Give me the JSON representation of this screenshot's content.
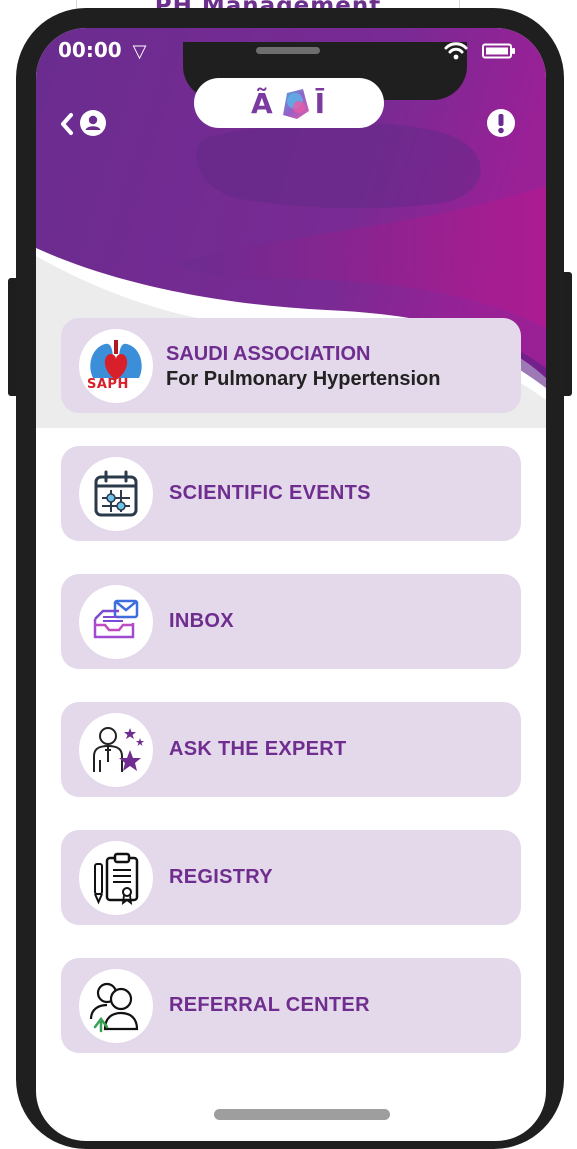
{
  "banner": {
    "title": "PH Management"
  },
  "status": {
    "time": "00:00",
    "nav_glyph": "▽"
  },
  "header": {
    "logo_text_left": "Ã",
    "logo_text_right": "Ī"
  },
  "menu": [
    {
      "line1": "SAUDI ASSOCIATION",
      "line2": "For Pulmonary Hypertension",
      "badge": "SAPH"
    },
    {
      "label": "SCIENTIFIC EVENTS"
    },
    {
      "label": "INBOX"
    },
    {
      "label": "ASK THE EXPERT"
    },
    {
      "label": "REGISTRY"
    },
    {
      "label": "REFERRAL CENTER"
    }
  ],
  "colors": {
    "header_purple": "#6d2b8e",
    "accent_magenta": "#a0208c",
    "card_bg": "#e4d9ea",
    "label_purple": "#6e2d8f"
  }
}
